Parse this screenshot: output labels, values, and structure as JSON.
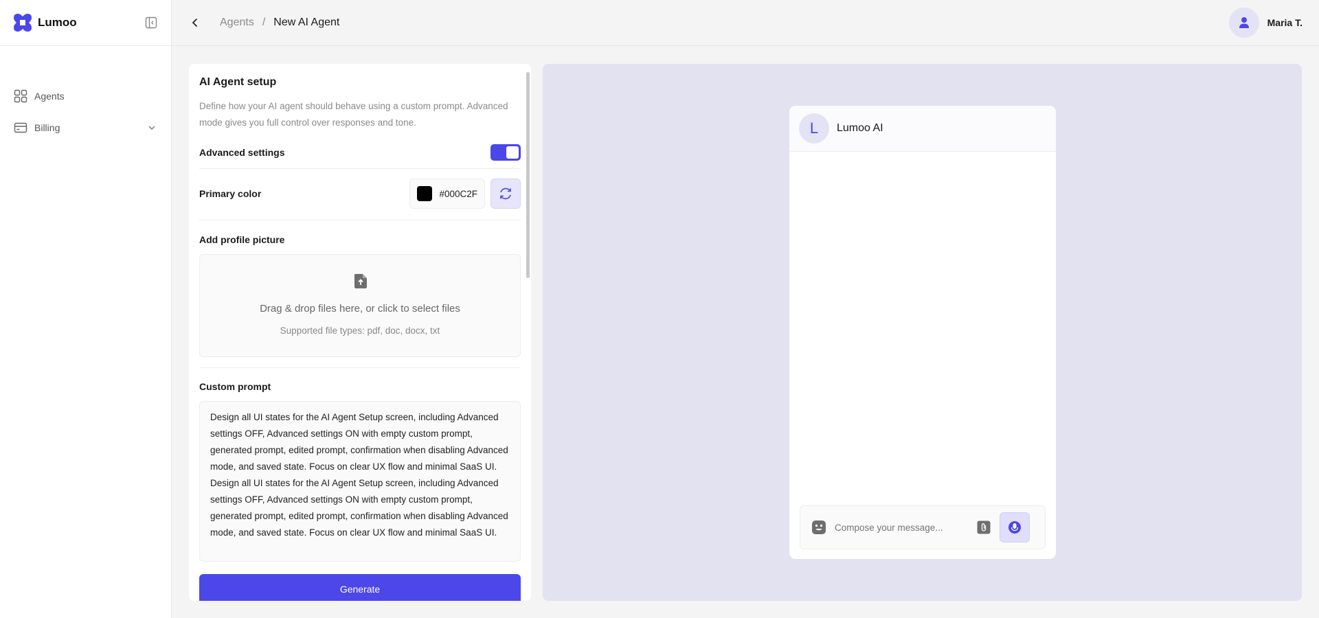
{
  "brand": {
    "name": "Lumoo"
  },
  "sidebar": {
    "items": [
      {
        "label": "Agents",
        "icon": "grid-icon"
      },
      {
        "label": "Billing",
        "icon": "card-icon"
      }
    ]
  },
  "header": {
    "breadcrumb": {
      "parent": "Agents",
      "separator": "/",
      "current": "New AI Agent"
    },
    "user_name": "Maria T."
  },
  "setup": {
    "title": "AI Agent setup",
    "description": "Define how your AI agent should behave using a custom prompt. Advanced mode gives you full control over responses and tone.",
    "advanced_label": "Advanced settings",
    "advanced_on": true,
    "primary_color_label": "Primary color",
    "primary_color_value": "#000C2F",
    "profile_label": "Add profile picture",
    "drop_main": "Drag & drop files here, or click to select files",
    "drop_sub": "Supported file types: pdf, doc, docx, txt",
    "prompt_label": "Custom prompt",
    "prompt_text": "Design all UI states for the AI Agent Setup screen, including Advanced settings OFF, Advanced settings ON with empty custom prompt, generated prompt, edited prompt, confirmation when disabling Advanced mode, and saved state. Focus on clear UX flow and minimal SaaS UI. Design all UI states for the AI Agent Setup screen, including Advanced settings OFF, Advanced settings ON with empty custom prompt, generated prompt, edited prompt, confirmation when disabling Advanced mode, and saved state. Focus on clear UX flow and minimal SaaS UI.",
    "generate_label": "Generate"
  },
  "preview": {
    "avatar_letter": "L",
    "agent_name": "Lumoo AI",
    "composer_placeholder": "Compose your message..."
  },
  "colors": {
    "accent": "#4B47E8",
    "accent_soft": "#E4E3F5",
    "preview_bg": "#E3E2F0"
  }
}
